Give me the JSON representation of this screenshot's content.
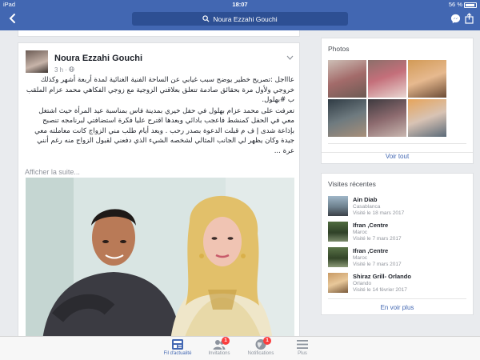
{
  "status_bar": {
    "carrier": "iPad",
    "time": "18:07",
    "battery": "56 %"
  },
  "header": {
    "search_text": "Noura Ezzahi Gouchi"
  },
  "post": {
    "author": "Noura Ezzahi Gouchi",
    "meta": "3 h · ",
    "paragraph_1": "عاااجل :تصريح خطير يوضح سبب غيابي عن الساحة الفنية الغنائية لمدة أربعة أشهر وكذلك خروجي ولأول مرة بحقائق صادمة تتعلق بعلاقتي الزوجية مع زوجي الفكاهي محمد عزام الملقب ب #بهلول.",
    "paragraph_2": "تعرفت على محمد عزام بهلول في حفل خيري بمدينة فاس بمناسبة عيد المرأة حيث اشتغل معي في الحفل كمنشط فاعجب بادائي وبعدها اقترح عليا فكرة استضافتي لبرنامجه تنصبح بإذاعة شدى إ ف م قبلت الدعوة بصدر رحب . وبعد أيام طلب مني الزواج كانت معاملته معي جيدة وكان يظهر لي الجانب المثالي لشخصه الشيء الذي دفعني لقبول الزواج منه رغم أنني عرة ...",
    "see_more": "Afficher la suite..."
  },
  "photos_card": {
    "title": "Photos",
    "footer": "Voir tout",
    "thumbs": [
      "photo-1",
      "photo-2",
      "photo-3",
      "photo-4",
      "photo-5",
      "photo-6"
    ]
  },
  "visits_card": {
    "title": "Visites récentes",
    "items": [
      {
        "name": "Ain Diab",
        "location": "Casablanca",
        "date": "Visité le 18 mars 2017"
      },
      {
        "name": "Ifran ,Centre",
        "location": "Maroc",
        "date": "Visité le 7 mars 2017"
      },
      {
        "name": "Ifran ,Centre",
        "location": "Maroc",
        "date": "Visité le 7 mars 2017"
      },
      {
        "name": "Shiraz Grill- Orlando",
        "location": "Orlando",
        "date": "Visité le 14 février 2017"
      }
    ],
    "footer": "En voir plus"
  },
  "tabbar": {
    "tabs": [
      {
        "label": "Fil d'actualité",
        "badge": ""
      },
      {
        "label": "Invitations",
        "badge": "1"
      },
      {
        "label": "Notifications",
        "badge": "1"
      },
      {
        "label": "Plus",
        "badge": ""
      }
    ]
  },
  "colors": {
    "brand": "#4267b2",
    "badge": "#fa3e3e",
    "background": "#e9ebee"
  }
}
